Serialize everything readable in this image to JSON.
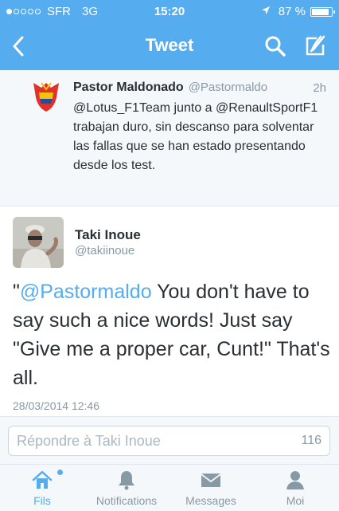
{
  "status": {
    "carrier": "SFR",
    "network": "3G",
    "time": "15:20",
    "battery_text": "87 %",
    "battery_level": 0.87
  },
  "nav": {
    "title": "Tweet",
    "back_icon": "chevron-left-icon",
    "search_icon": "search-icon",
    "compose_icon": "compose-icon"
  },
  "previous_tweet": {
    "name": "Pastor Maldonado",
    "handle": "@Pastormaldo",
    "time": "2h",
    "text": "@Lotus_F1Team junto a @RenaultSportF1 trabajan duro, sin descanso para solventar las fallas que se han estado presentando desde los test."
  },
  "main_tweet": {
    "name": "Taki Inoue",
    "handle": "@takiinoue",
    "quote_open": "\"",
    "mention": "@Pastormaldo",
    "text": " You don't have to say such a nice words! Just say \"Give me a proper car, Cunt!\" That's all.",
    "date": "28/03/2014 12:46"
  },
  "reply": {
    "placeholder": "Répondre à Taki Inoue",
    "char_count": "116"
  },
  "tabs": [
    {
      "label": "Fils",
      "icon": "home-icon",
      "active": true
    },
    {
      "label": "Notifications",
      "icon": "bell-icon",
      "active": false
    },
    {
      "label": "Messages",
      "icon": "envelope-icon",
      "active": false
    },
    {
      "label": "Moi",
      "icon": "person-icon",
      "active": false
    }
  ],
  "colors": {
    "accent": "#55acee",
    "text": "#292f33",
    "muted": "#8899a6",
    "background": "#f5f8fa"
  }
}
